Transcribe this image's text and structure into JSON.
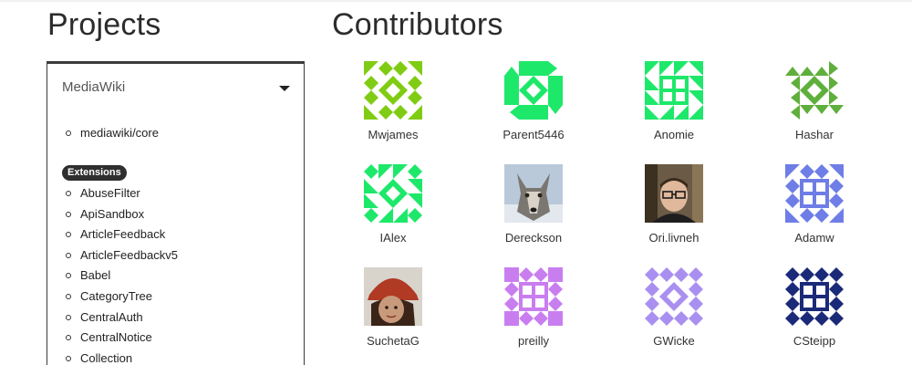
{
  "projects": {
    "title": "Projects",
    "selected": "MediaWiki",
    "core": [
      "mediawiki/core"
    ],
    "extensions_label": "Extensions",
    "extensions": [
      "AbuseFilter",
      "ApiSandbox",
      "ArticleFeedback",
      "ArticleFeedbackv5",
      "Babel",
      "CategoryTree",
      "CentralAuth",
      "CentralNotice",
      "Collection"
    ]
  },
  "contributors": {
    "title": "Contributors",
    "people": [
      {
        "name": "Mwjames",
        "avatar": "identicon",
        "color": "#80cc14"
      },
      {
        "name": "Parent5446",
        "avatar": "identicon",
        "color": "#1ee86a"
      },
      {
        "name": "Anomie",
        "avatar": "identicon",
        "color": "#1ee86a"
      },
      {
        "name": "Hashar",
        "avatar": "identicon",
        "color": "#5faf3c"
      },
      {
        "name": "IAlex",
        "avatar": "identicon",
        "color": "#1ee86a"
      },
      {
        "name": "Dereckson",
        "avatar": "photo-wolf"
      },
      {
        "name": "Ori.livneh",
        "avatar": "photo-person-glasses"
      },
      {
        "name": "Adamw",
        "avatar": "identicon",
        "color": "#6e7ee6"
      },
      {
        "name": "SuchetaG",
        "avatar": "photo-person-hat"
      },
      {
        "name": "preilly",
        "avatar": "identicon",
        "color": "#c97ef0"
      },
      {
        "name": "GWicke",
        "avatar": "identicon",
        "color": "#a990f0"
      },
      {
        "name": "CSteipp",
        "avatar": "identicon",
        "color": "#1b2a78"
      }
    ]
  }
}
